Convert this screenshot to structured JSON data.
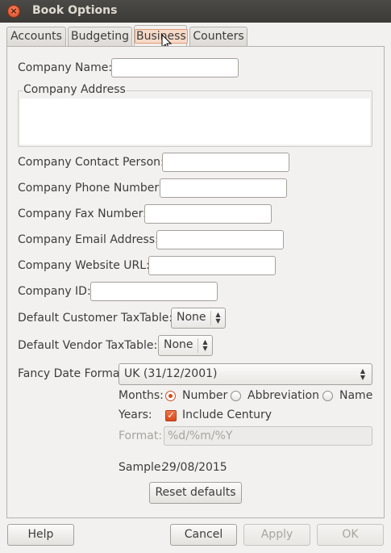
{
  "window": {
    "title": "Book Options",
    "close_icon": "close-icon"
  },
  "tabs": [
    {
      "label": "Accounts",
      "active": false
    },
    {
      "label": "Budgeting",
      "active": false
    },
    {
      "label": "Business",
      "active": true
    },
    {
      "label": "Counters",
      "active": false
    }
  ],
  "business": {
    "company_name_label": "Company Name:",
    "company_address_label": "Company Address",
    "contact_person_label": "Company Contact Person:",
    "phone_label": "Company Phone Number:",
    "fax_label": "Company Fax Number:",
    "email_label": "Company Email Address:",
    "website_label": "Company Website URL:",
    "company_id_label": "Company ID:",
    "customer_taxtable_label": "Default Customer TaxTable:",
    "customer_taxtable_value": "None",
    "vendor_taxtable_label": "Default Vendor TaxTable:",
    "vendor_taxtable_value": "None",
    "date_format_label": "Fancy Date Format",
    "date_format_value": "UK (31/12/2001)",
    "months_label": "Months:",
    "months_options": [
      "Number",
      "Abbreviation",
      "Name"
    ],
    "months_selected": "Number",
    "years_label": "Years:",
    "include_century_label": "Include Century",
    "include_century_checked": true,
    "format_label": "Format:",
    "format_placeholder": "%d/%m/%Y",
    "sample_label": "Sample:",
    "sample_value": "29/08/2015",
    "reset_button": "Reset defaults"
  },
  "buttons": {
    "help": "Help",
    "cancel": "Cancel",
    "apply": "Apply",
    "ok": "OK"
  },
  "colors": {
    "accent": "#dd4814",
    "titlebar": "#3c3b37"
  }
}
